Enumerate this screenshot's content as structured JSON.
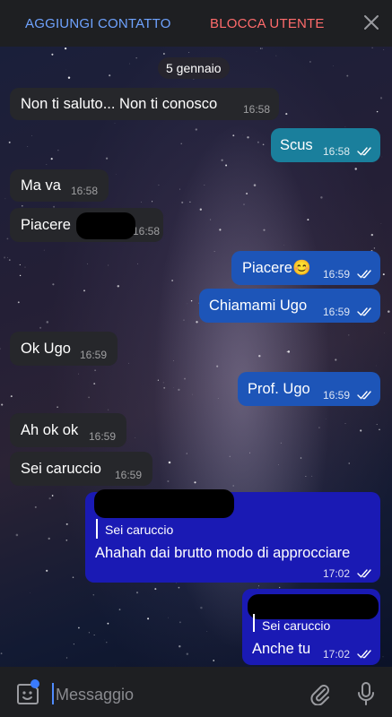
{
  "header": {
    "add_contact": "AGGIUNGI CONTATTO",
    "block_user": "BLOCCA UTENTE",
    "close_icon": "close-icon"
  },
  "date_separator": "5 gennaio",
  "messages": [
    {
      "side": "in",
      "text": "Non ti saluto... Non ti conosco",
      "time": "16:58"
    },
    {
      "side": "out",
      "text": "Scus",
      "time": "16:58",
      "status": "read"
    },
    {
      "side": "in",
      "text": "Ma va",
      "time": "16:58"
    },
    {
      "side": "in",
      "text": "Piacere",
      "time": "16:58",
      "redacted": true
    },
    {
      "side": "out",
      "text": "Piacere😊",
      "time": "16:59",
      "status": "read"
    },
    {
      "side": "out",
      "text": "Chiamami Ugo",
      "time": "16:59",
      "status": "read"
    },
    {
      "side": "in",
      "text": "Ok Ugo",
      "time": "16:59"
    },
    {
      "side": "out",
      "text": "Prof. Ugo",
      "time": "16:59",
      "status": "read"
    },
    {
      "side": "in",
      "text": "Ah ok ok",
      "time": "16:59"
    },
    {
      "side": "in",
      "text": "Sei caruccio",
      "time": "16:59"
    },
    {
      "side": "out",
      "reply_to": "Sei caruccio",
      "text": "Ahahah dai brutto modo di approcciare",
      "time": "17:02",
      "status": "read"
    },
    {
      "side": "out",
      "reply_to": "Sei caruccio",
      "text": "Anche tu",
      "time": "17:02",
      "status": "read"
    }
  ],
  "composer": {
    "placeholder": "Messaggio",
    "emoji_icon": "sticker-emoji-icon",
    "attach_icon": "paperclip-icon",
    "mic_icon": "microphone-icon"
  },
  "colors": {
    "bar": "#1e1f22",
    "incoming": "#26272b",
    "outgoing_teal": "#1a7f9c",
    "outgoing_blue": "#1d55b8",
    "outgoing_deep": "#1a1ab4",
    "accent_blue": "#6fa3ff",
    "accent_red": "#ff6b6b"
  }
}
